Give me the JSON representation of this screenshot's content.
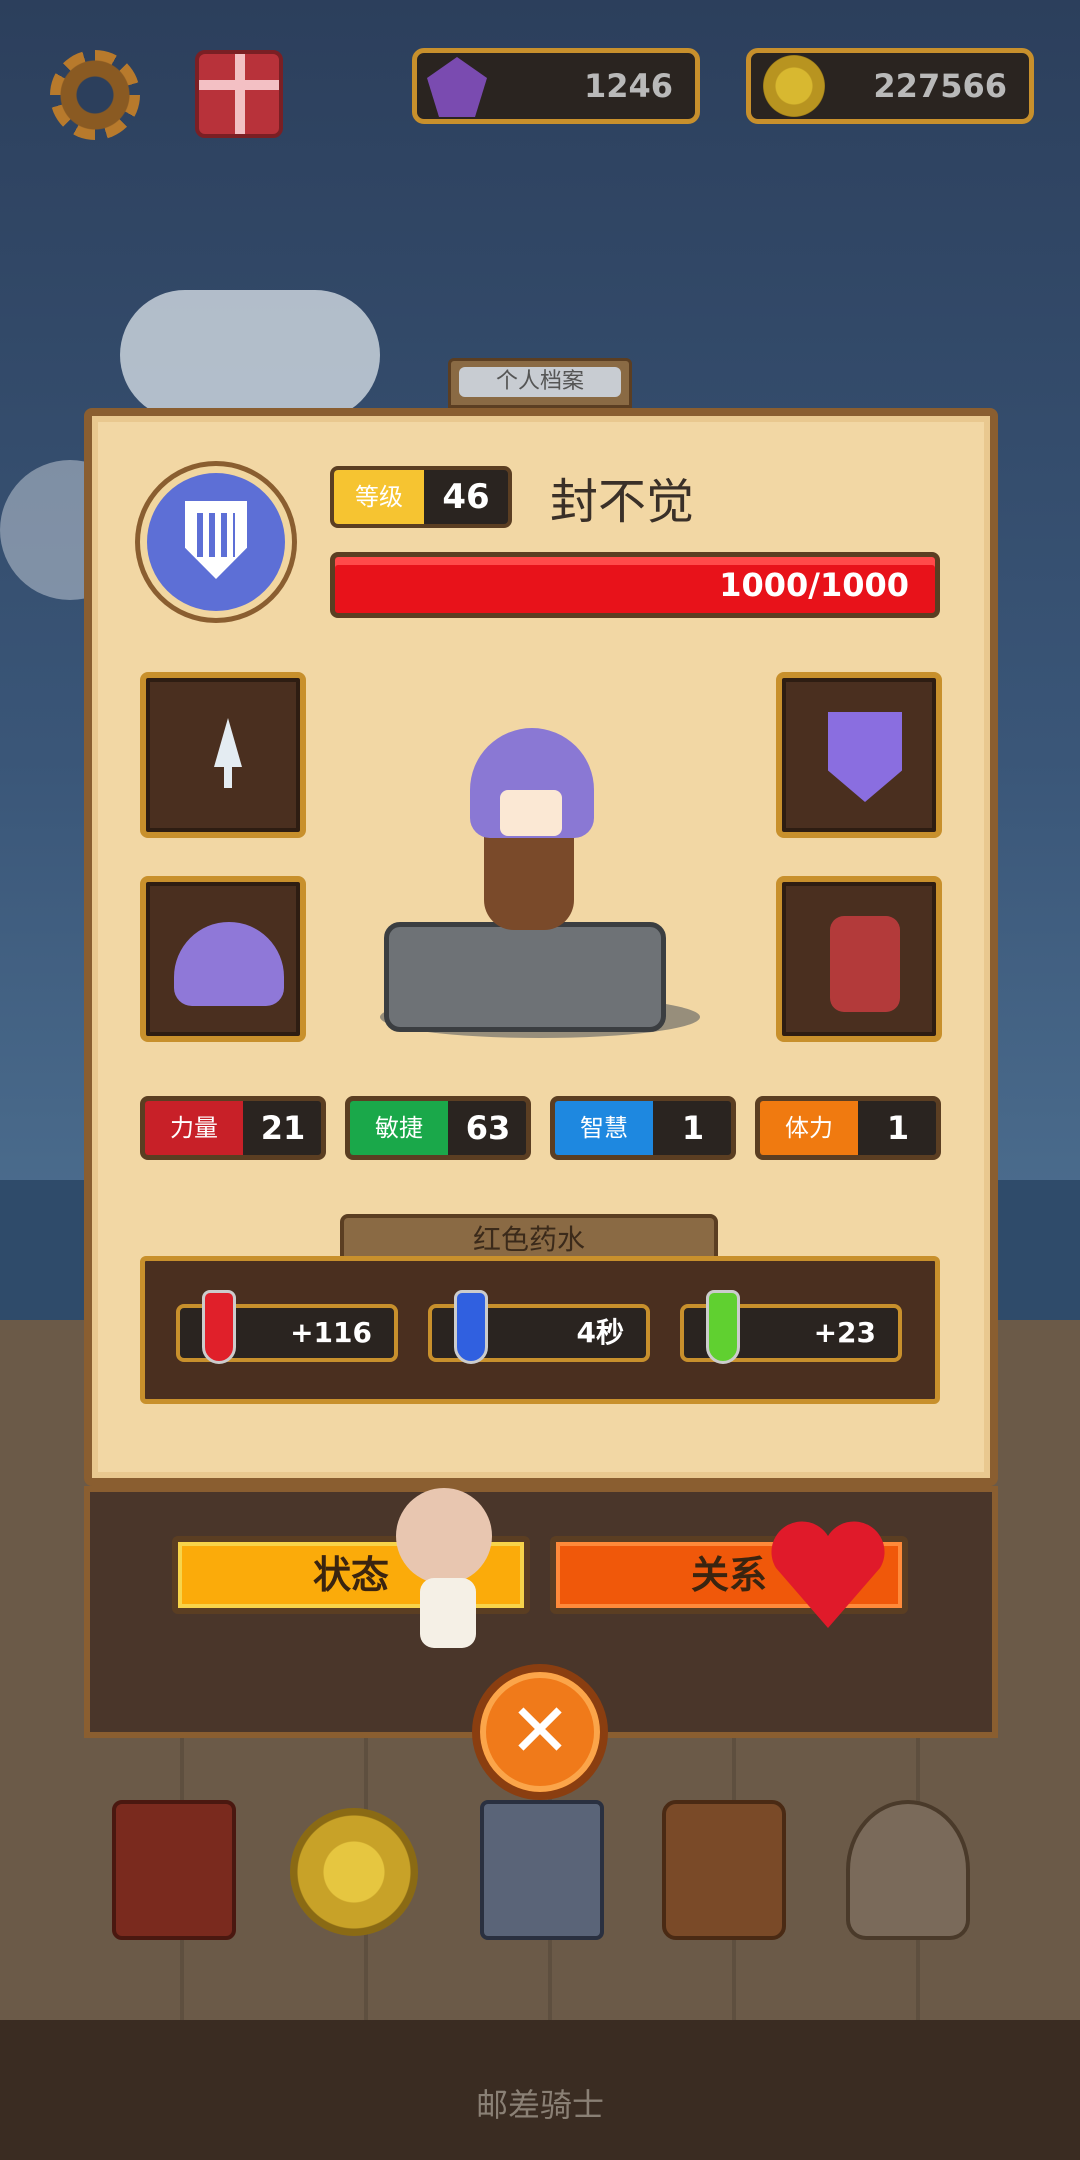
{
  "resources": {
    "gems": "1246",
    "coins": "227566"
  },
  "profile_tab": "个人档案",
  "player": {
    "level_label": "等级",
    "level": "46",
    "name": "封不觉",
    "hp_text": "1000/1000"
  },
  "stats": [
    {
      "label": "力量",
      "value": "21",
      "color": "#c82028"
    },
    {
      "label": "敏捷",
      "value": "63",
      "color": "#1aa84a"
    },
    {
      "label": "智慧",
      "value": "1",
      "color": "#1e88e0"
    },
    {
      "label": "体力",
      "value": "1",
      "color": "#f07a10"
    }
  ],
  "potions": {
    "title": "红色药水",
    "items": [
      {
        "value": "+116",
        "color": "#e0202a",
        "icon": "heart-icon"
      },
      {
        "value": "4秒",
        "color": "#3060e0",
        "icon": "hourglass-icon"
      },
      {
        "value": "+23",
        "color": "#60d030",
        "icon": "shield-icon"
      }
    ]
  },
  "buttons": {
    "status": "状态",
    "relation": "关系"
  },
  "footer": "邮差骑士"
}
